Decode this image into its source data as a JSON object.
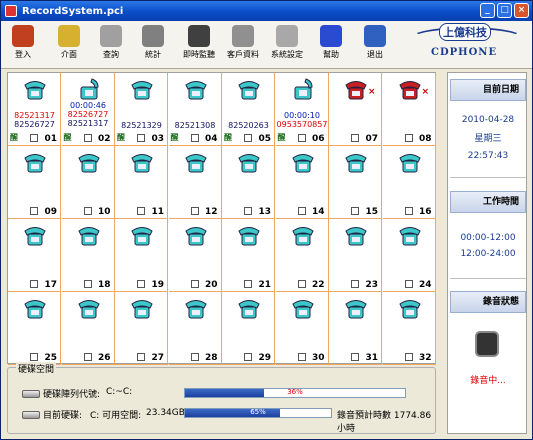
{
  "window": {
    "title": "RecordSystem.pci"
  },
  "toolbar": [
    {
      "label": "登入",
      "icon": "users-icon",
      "color": "#c04020"
    },
    {
      "label": "介面",
      "icon": "folder-icon",
      "color": "#d8b030"
    },
    {
      "label": "查詢",
      "icon": "query-icon",
      "color": "#a0a0a0"
    },
    {
      "label": "統計",
      "icon": "pie-chart-icon",
      "color": "#808080"
    },
    {
      "label": "即時監聽",
      "icon": "headset-icon",
      "color": "#404040"
    },
    {
      "label": "客戶資料",
      "icon": "customers-icon",
      "color": "#909090"
    },
    {
      "label": "系統設定",
      "icon": "gear-icon",
      "color": "#a8a8a8"
    },
    {
      "label": "幫助",
      "icon": "help-icon",
      "color": "#2a4ad0"
    },
    {
      "label": "退出",
      "icon": "exit-icon",
      "color": "#3060c0"
    }
  ],
  "logo": {
    "chinese": "上億科技",
    "english": "CDPHONE"
  },
  "lines": [
    {
      "number": "01",
      "status": "醒",
      "info": [
        {
          "t": "82521317",
          "c": "red"
        },
        {
          "t": "82526727",
          "c": "navy"
        }
      ],
      "phone": "idle"
    },
    {
      "number": "02",
      "status": "醒",
      "info": [
        {
          "t": "00:00:46",
          "c": "blue"
        },
        {
          "t": "82526727",
          "c": "red"
        },
        {
          "t": "82521317",
          "c": "navy"
        }
      ],
      "phone": "active"
    },
    {
      "number": "03",
      "status": "醒",
      "info": [
        {
          "t": "82521329",
          "c": "navy"
        }
      ],
      "phone": "idle"
    },
    {
      "number": "04",
      "status": "醒",
      "info": [
        {
          "t": "82521308",
          "c": "navy"
        }
      ],
      "phone": "idle"
    },
    {
      "number": "05",
      "status": "醒",
      "info": [
        {
          "t": "82520263",
          "c": "navy"
        }
      ],
      "phone": "idle"
    },
    {
      "number": "06",
      "status": "醒",
      "info": [
        {
          "t": "00:00:10",
          "c": "blue"
        },
        {
          "t": "0953570857",
          "c": "red"
        }
      ],
      "phone": "active"
    },
    {
      "number": "07",
      "status": "",
      "info": [],
      "phone": "error"
    },
    {
      "number": "08",
      "status": "",
      "info": [],
      "phone": "error"
    },
    {
      "number": "09",
      "status": "",
      "info": [],
      "phone": "idle"
    },
    {
      "number": "10",
      "status": "",
      "info": [],
      "phone": "idle"
    },
    {
      "number": "11",
      "status": "",
      "info": [],
      "phone": "idle"
    },
    {
      "number": "12",
      "status": "",
      "info": [],
      "phone": "idle"
    },
    {
      "number": "13",
      "status": "",
      "info": [],
      "phone": "idle"
    },
    {
      "number": "14",
      "status": "",
      "info": [],
      "phone": "idle"
    },
    {
      "number": "15",
      "status": "",
      "info": [],
      "phone": "idle"
    },
    {
      "number": "16",
      "status": "",
      "info": [],
      "phone": "idle"
    },
    {
      "number": "17",
      "status": "",
      "info": [],
      "phone": "idle"
    },
    {
      "number": "18",
      "status": "",
      "info": [],
      "phone": "idle"
    },
    {
      "number": "19",
      "status": "",
      "info": [],
      "phone": "idle"
    },
    {
      "number": "20",
      "status": "",
      "info": [],
      "phone": "idle"
    },
    {
      "number": "21",
      "status": "",
      "info": [],
      "phone": "idle"
    },
    {
      "number": "22",
      "status": "",
      "info": [],
      "phone": "idle"
    },
    {
      "number": "23",
      "status": "",
      "info": [],
      "phone": "idle"
    },
    {
      "number": "24",
      "status": "",
      "info": [],
      "phone": "idle"
    },
    {
      "number": "25",
      "status": "",
      "info": [],
      "phone": "idle"
    },
    {
      "number": "26",
      "status": "",
      "info": [],
      "phone": "idle"
    },
    {
      "number": "27",
      "status": "",
      "info": [],
      "phone": "idle"
    },
    {
      "number": "28",
      "status": "",
      "info": [],
      "phone": "idle"
    },
    {
      "number": "29",
      "status": "",
      "info": [],
      "phone": "idle"
    },
    {
      "number": "30",
      "status": "",
      "info": [],
      "phone": "idle"
    },
    {
      "number": "31",
      "status": "",
      "info": [],
      "phone": "idle"
    },
    {
      "number": "32",
      "status": "",
      "info": [],
      "phone": "idle"
    }
  ],
  "side": {
    "date_label": "目前日期",
    "date": "2010-04-28",
    "weekday": "星期三",
    "time": "22:57:43",
    "work_label": "工作時間",
    "work1": "00:00-12:00",
    "work2": "12:00-24:00",
    "rec_label": "錄音狀態",
    "rec_status": "錄音中..."
  },
  "disk": {
    "legend": "硬碟空間",
    "drive_label": "硬碟陣列代號:",
    "drive_value": "C:~C:",
    "used_pct": 36,
    "current_label": "目前硬碟:",
    "current_value": "C: 可用空間:",
    "free": "23.34GB",
    "free_pct": 65,
    "estimate": "錄音預計時數 1774.86小時"
  },
  "colors": {
    "phone_idle": "#3cc8c8",
    "phone_error": "#c82020",
    "cell_border": "#f0a860"
  }
}
